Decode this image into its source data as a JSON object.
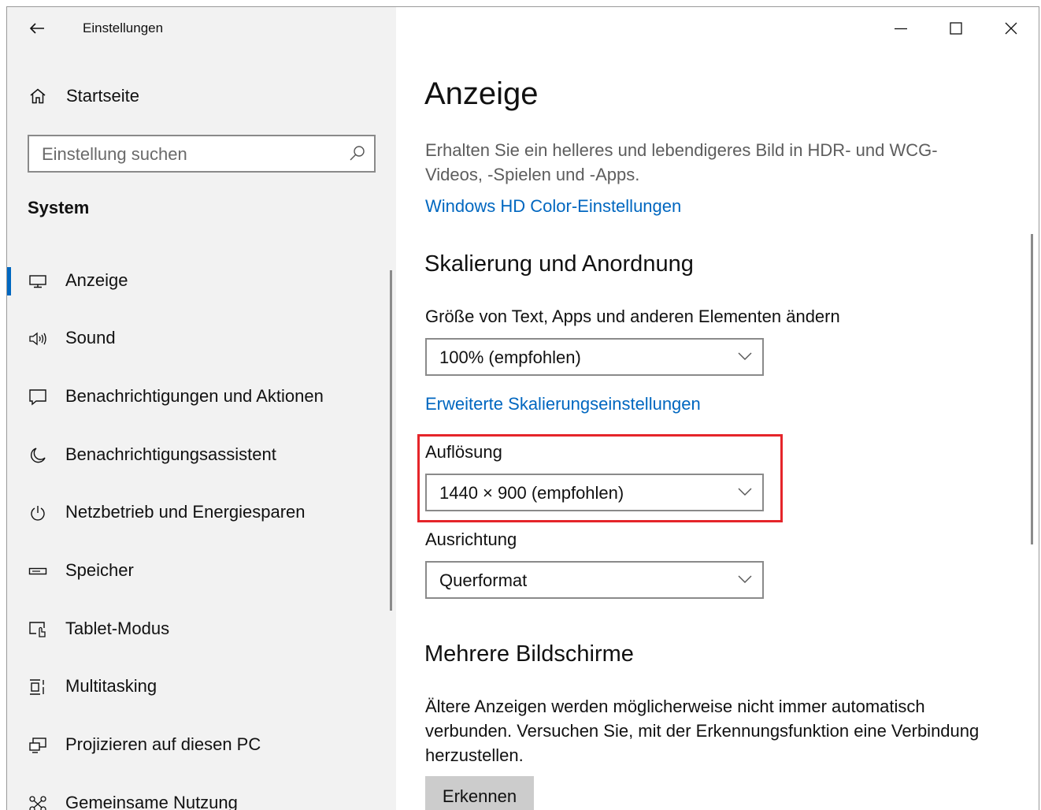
{
  "window": {
    "title": "Einstellungen",
    "controls": [
      "minimize",
      "maximize",
      "close"
    ]
  },
  "sidebar": {
    "home_label": "Startseite",
    "search_placeholder": "Einstellung suchen",
    "section_title": "System",
    "items": [
      {
        "label": "Anzeige",
        "icon": "monitor-icon",
        "active": true
      },
      {
        "label": "Sound",
        "icon": "speaker-icon",
        "active": false
      },
      {
        "label": "Benachrichtigungen und Aktionen",
        "icon": "message-icon",
        "active": false
      },
      {
        "label": "Benachrichtigungsassistent",
        "icon": "moon-icon",
        "active": false
      },
      {
        "label": "Netzbetrieb und Energiesparen",
        "icon": "power-icon",
        "active": false
      },
      {
        "label": "Speicher",
        "icon": "storage-icon",
        "active": false
      },
      {
        "label": "Tablet-Modus",
        "icon": "tablet-mode-icon",
        "active": false
      },
      {
        "label": "Multitasking",
        "icon": "multitasking-icon",
        "active": false
      },
      {
        "label": "Projizieren auf diesen PC",
        "icon": "projecting-icon",
        "active": false
      },
      {
        "label": "Gemeinsame Nutzung",
        "icon": "shared-experiences-icon",
        "active": false
      }
    ]
  },
  "main": {
    "title": "Anzeige",
    "hdr_description": "Erhalten Sie ein helleres und lebendigeres Bild in HDR- und WCG-Videos, -Spielen und -Apps.",
    "hdr_link": "Windows HD Color-Einstellungen",
    "scale_section": "Skalierung und Anordnung",
    "scale_label": "Größe von Text, Apps und anderen Elementen ändern",
    "scale_value": "100% (empfohlen)",
    "advanced_scale_link": "Erweiterte Skalierungseinstellungen",
    "resolution_label": "Auflösung",
    "resolution_value": "1440 × 900 (empfohlen)",
    "orientation_label": "Ausrichtung",
    "orientation_value": "Querformat",
    "multi_section": "Mehrere Bildschirme",
    "multi_description": "Ältere Anzeigen werden möglicherweise nicht immer automatisch verbunden. Versuchen Sie, mit der Erkennungsfunktion eine Verbindung herzustellen.",
    "detect_button": "Erkennen"
  },
  "colors": {
    "accent": "#0067c0",
    "highlight": "#e5252a",
    "sidebar_bg": "#f2f2f2"
  }
}
